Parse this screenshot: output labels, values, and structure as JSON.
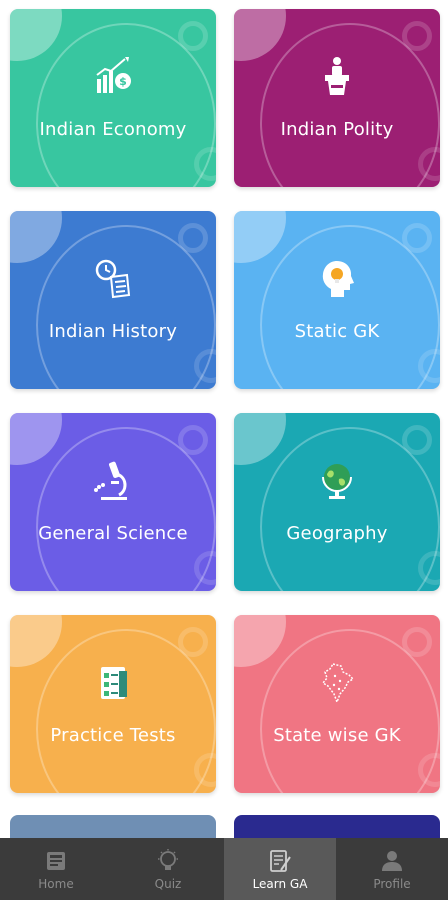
{
  "cards": [
    {
      "label": "Indian Economy",
      "icon": "economy-chart-icon",
      "color": "#38c6a0"
    },
    {
      "label": "Indian Polity",
      "icon": "podium-speaker-icon",
      "color": "#9c1f73"
    },
    {
      "label": "Indian History",
      "icon": "history-scroll-icon",
      "color": "#3d7bd1"
    },
    {
      "label": "Static GK",
      "icon": "head-lightbulb-icon",
      "color": "#5ab3f2"
    },
    {
      "label": "General Science",
      "icon": "microscope-icon",
      "color": "#6b5de6"
    },
    {
      "label": "Geography",
      "icon": "globe-icon",
      "color": "#1ba8b3"
    },
    {
      "label": "Practice Tests",
      "icon": "checklist-icon",
      "color": "#f7b04d"
    },
    {
      "label": "State wise GK",
      "icon": "india-map-icon",
      "color": "#f07583"
    }
  ],
  "partial_cards": [
    {
      "color": "#6f8fb4"
    },
    {
      "color": "#2a2a8f"
    }
  ],
  "nav": [
    {
      "label": "Home",
      "icon": "home-book-icon",
      "active": false
    },
    {
      "label": "Quiz",
      "icon": "lightbulb-icon",
      "active": false
    },
    {
      "label": "Learn GA",
      "icon": "notepad-pen-icon",
      "active": true
    },
    {
      "label": "Profile",
      "icon": "person-icon",
      "active": false
    }
  ]
}
